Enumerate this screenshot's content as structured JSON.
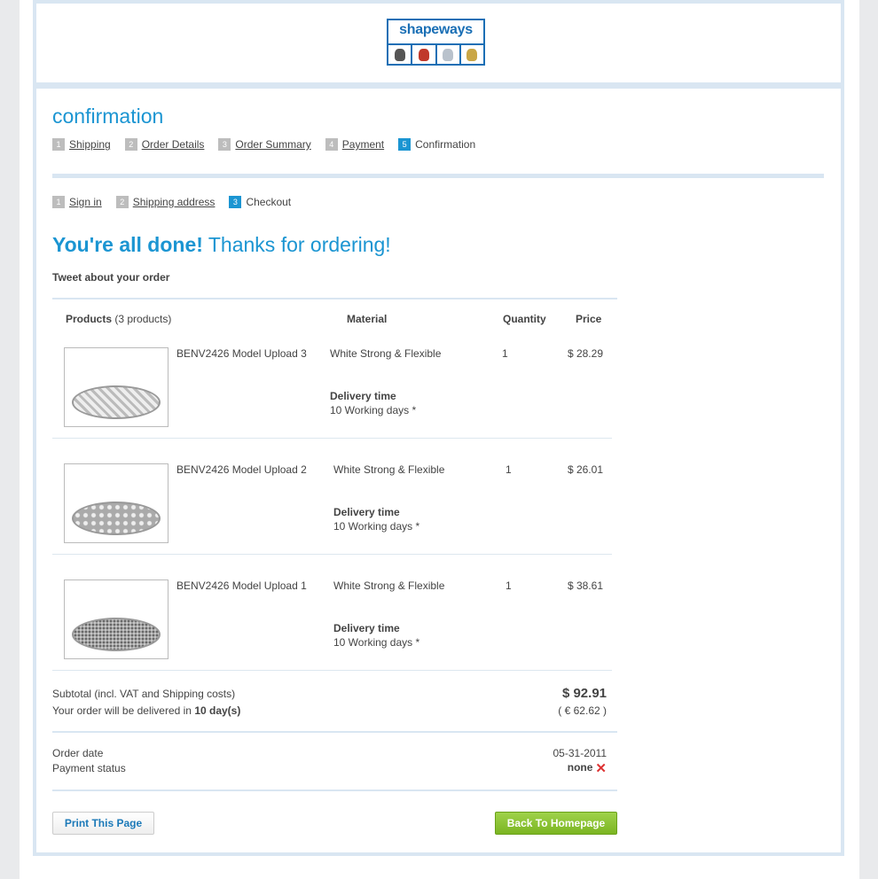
{
  "logo": {
    "text": "shapeways"
  },
  "page_title": "confirmation",
  "steps_main": [
    {
      "num": "1",
      "label": "Shipping",
      "link": true
    },
    {
      "num": "2",
      "label": "Order Details",
      "link": true
    },
    {
      "num": "3",
      "label": "Order Summary",
      "link": true
    },
    {
      "num": "4",
      "label": "Payment",
      "link": true
    },
    {
      "num": "5",
      "label": "Confirmation",
      "link": false
    }
  ],
  "steps_sub": [
    {
      "num": "1",
      "label": "Sign in",
      "link": true
    },
    {
      "num": "2",
      "label": "Shipping address",
      "link": true
    },
    {
      "num": "3",
      "label": "Checkout",
      "link": false
    }
  ],
  "done_bold": "You're all done!",
  "done_rest": " Thanks for ordering!",
  "tweet": "Tweet about your order",
  "table": {
    "col_products": "Products",
    "col_products_count": "(3 products)",
    "col_material": "Material",
    "col_quantity": "Quantity",
    "col_price": "Price"
  },
  "products": [
    {
      "name": "BENV2426 Model Upload 3",
      "material": "White Strong & Flexible",
      "delivery_label": "Delivery time",
      "delivery": "10 Working days *",
      "quantity": "1",
      "price": "$ 28.29"
    },
    {
      "name": "BENV2426 Model Upload 2",
      "material": "White Strong & Flexible",
      "delivery_label": "Delivery time",
      "delivery": "10 Working days *",
      "quantity": "1",
      "price": "$ 26.01"
    },
    {
      "name": "BENV2426 Model Upload 1",
      "material": "White Strong & Flexible",
      "delivery_label": "Delivery time",
      "delivery": "10 Working days *",
      "quantity": "1",
      "price": "$ 38.61"
    }
  ],
  "summary": {
    "subtotal_label": "Subtotal (incl. VAT and Shipping costs)",
    "delivered_prefix": "Your order will be delivered in ",
    "delivered_days": "10 day(s)",
    "total_usd": "$ 92.91",
    "total_eur": "( € 62.62 )"
  },
  "order": {
    "date_label": "Order date",
    "date_value": "05-31-2011",
    "payment_label": "Payment status",
    "payment_value": "none"
  },
  "buttons": {
    "print": "Print This Page",
    "home": "Back To Homepage"
  },
  "colors": {
    "accent": "#1b95d2",
    "frame": "#d9e6f2",
    "button_green": "#8cc43a"
  }
}
